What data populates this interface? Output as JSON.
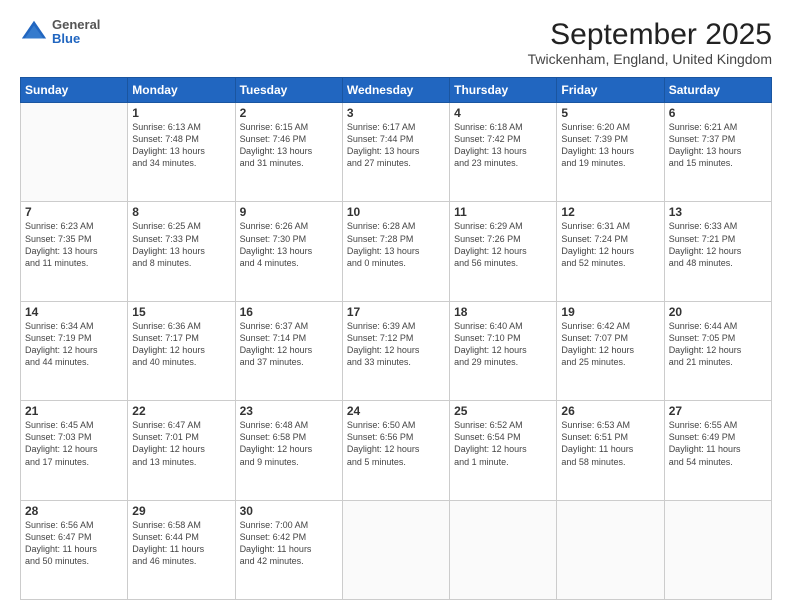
{
  "header": {
    "logo": {
      "general": "General",
      "blue": "Blue"
    },
    "title": "September 2025",
    "subtitle": "Twickenham, England, United Kingdom"
  },
  "weekdays": [
    "Sunday",
    "Monday",
    "Tuesday",
    "Wednesday",
    "Thursday",
    "Friday",
    "Saturday"
  ],
  "rows": [
    [
      {
        "day": "",
        "info": ""
      },
      {
        "day": "1",
        "info": "Sunrise: 6:13 AM\nSunset: 7:48 PM\nDaylight: 13 hours\nand 34 minutes."
      },
      {
        "day": "2",
        "info": "Sunrise: 6:15 AM\nSunset: 7:46 PM\nDaylight: 13 hours\nand 31 minutes."
      },
      {
        "day": "3",
        "info": "Sunrise: 6:17 AM\nSunset: 7:44 PM\nDaylight: 13 hours\nand 27 minutes."
      },
      {
        "day": "4",
        "info": "Sunrise: 6:18 AM\nSunset: 7:42 PM\nDaylight: 13 hours\nand 23 minutes."
      },
      {
        "day": "5",
        "info": "Sunrise: 6:20 AM\nSunset: 7:39 PM\nDaylight: 13 hours\nand 19 minutes."
      },
      {
        "day": "6",
        "info": "Sunrise: 6:21 AM\nSunset: 7:37 PM\nDaylight: 13 hours\nand 15 minutes."
      }
    ],
    [
      {
        "day": "7",
        "info": "Sunrise: 6:23 AM\nSunset: 7:35 PM\nDaylight: 13 hours\nand 11 minutes."
      },
      {
        "day": "8",
        "info": "Sunrise: 6:25 AM\nSunset: 7:33 PM\nDaylight: 13 hours\nand 8 minutes."
      },
      {
        "day": "9",
        "info": "Sunrise: 6:26 AM\nSunset: 7:30 PM\nDaylight: 13 hours\nand 4 minutes."
      },
      {
        "day": "10",
        "info": "Sunrise: 6:28 AM\nSunset: 7:28 PM\nDaylight: 13 hours\nand 0 minutes."
      },
      {
        "day": "11",
        "info": "Sunrise: 6:29 AM\nSunset: 7:26 PM\nDaylight: 12 hours\nand 56 minutes."
      },
      {
        "day": "12",
        "info": "Sunrise: 6:31 AM\nSunset: 7:24 PM\nDaylight: 12 hours\nand 52 minutes."
      },
      {
        "day": "13",
        "info": "Sunrise: 6:33 AM\nSunset: 7:21 PM\nDaylight: 12 hours\nand 48 minutes."
      }
    ],
    [
      {
        "day": "14",
        "info": "Sunrise: 6:34 AM\nSunset: 7:19 PM\nDaylight: 12 hours\nand 44 minutes."
      },
      {
        "day": "15",
        "info": "Sunrise: 6:36 AM\nSunset: 7:17 PM\nDaylight: 12 hours\nand 40 minutes."
      },
      {
        "day": "16",
        "info": "Sunrise: 6:37 AM\nSunset: 7:14 PM\nDaylight: 12 hours\nand 37 minutes."
      },
      {
        "day": "17",
        "info": "Sunrise: 6:39 AM\nSunset: 7:12 PM\nDaylight: 12 hours\nand 33 minutes."
      },
      {
        "day": "18",
        "info": "Sunrise: 6:40 AM\nSunset: 7:10 PM\nDaylight: 12 hours\nand 29 minutes."
      },
      {
        "day": "19",
        "info": "Sunrise: 6:42 AM\nSunset: 7:07 PM\nDaylight: 12 hours\nand 25 minutes."
      },
      {
        "day": "20",
        "info": "Sunrise: 6:44 AM\nSunset: 7:05 PM\nDaylight: 12 hours\nand 21 minutes."
      }
    ],
    [
      {
        "day": "21",
        "info": "Sunrise: 6:45 AM\nSunset: 7:03 PM\nDaylight: 12 hours\nand 17 minutes."
      },
      {
        "day": "22",
        "info": "Sunrise: 6:47 AM\nSunset: 7:01 PM\nDaylight: 12 hours\nand 13 minutes."
      },
      {
        "day": "23",
        "info": "Sunrise: 6:48 AM\nSunset: 6:58 PM\nDaylight: 12 hours\nand 9 minutes."
      },
      {
        "day": "24",
        "info": "Sunrise: 6:50 AM\nSunset: 6:56 PM\nDaylight: 12 hours\nand 5 minutes."
      },
      {
        "day": "25",
        "info": "Sunrise: 6:52 AM\nSunset: 6:54 PM\nDaylight: 12 hours\nand 1 minute."
      },
      {
        "day": "26",
        "info": "Sunrise: 6:53 AM\nSunset: 6:51 PM\nDaylight: 11 hours\nand 58 minutes."
      },
      {
        "day": "27",
        "info": "Sunrise: 6:55 AM\nSunset: 6:49 PM\nDaylight: 11 hours\nand 54 minutes."
      }
    ],
    [
      {
        "day": "28",
        "info": "Sunrise: 6:56 AM\nSunset: 6:47 PM\nDaylight: 11 hours\nand 50 minutes."
      },
      {
        "day": "29",
        "info": "Sunrise: 6:58 AM\nSunset: 6:44 PM\nDaylight: 11 hours\nand 46 minutes."
      },
      {
        "day": "30",
        "info": "Sunrise: 7:00 AM\nSunset: 6:42 PM\nDaylight: 11 hours\nand 42 minutes."
      },
      {
        "day": "",
        "info": ""
      },
      {
        "day": "",
        "info": ""
      },
      {
        "day": "",
        "info": ""
      },
      {
        "day": "",
        "info": ""
      }
    ]
  ]
}
